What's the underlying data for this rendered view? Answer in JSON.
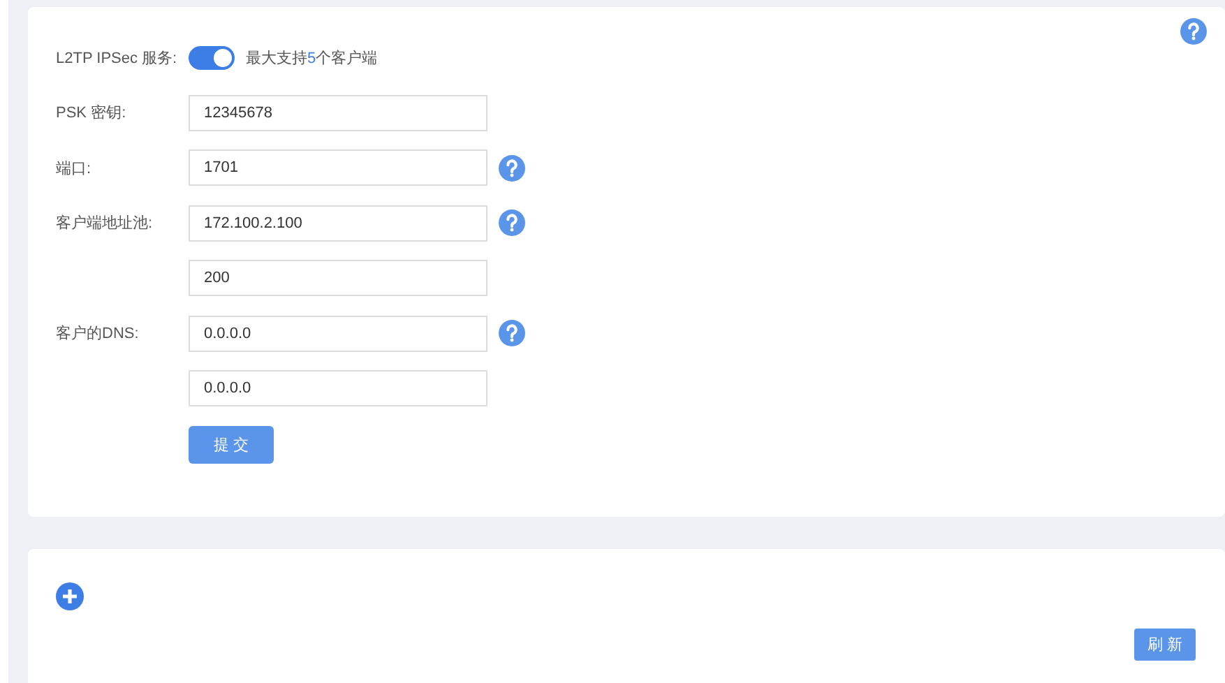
{
  "l2tp_panel": {
    "help": true,
    "service": {
      "label": "L2TP IPSec 服务:",
      "enabled": true,
      "note_prefix": "最大支持",
      "max_clients": "5",
      "note_suffix": "个客户端"
    },
    "fields": [
      {
        "label": "PSK 密钥:",
        "value": "12345678",
        "help": false
      },
      {
        "label": "端口:",
        "value": "1701",
        "help": true
      },
      {
        "label": "客户端地址池:",
        "value": "172.100.2.100",
        "help": true
      },
      {
        "value": "200",
        "help": false
      },
      {
        "label": "客户的DNS:",
        "value": "0.0.0.0",
        "help": true
      },
      {
        "value": "0.0.0.0",
        "help": false
      }
    ],
    "submit_button": "提 交"
  },
  "list_panel": {
    "refresh_button": "刷 新"
  }
}
